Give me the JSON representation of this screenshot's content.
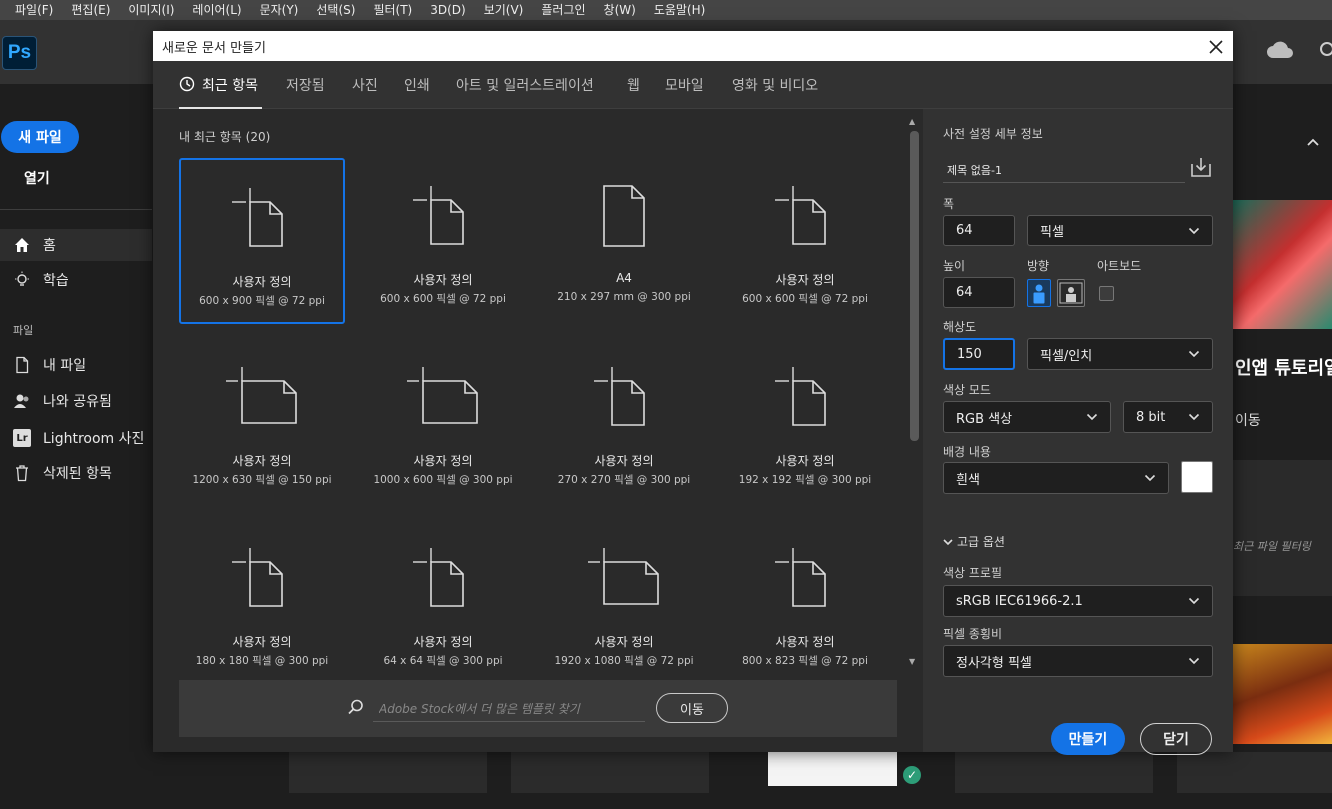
{
  "menubar": [
    "파일(F)",
    "편집(E)",
    "이미지(I)",
    "레이어(L)",
    "문자(Y)",
    "선택(S)",
    "필터(T)",
    "3D(D)",
    "보기(V)",
    "플러그인",
    "창(W)",
    "도움말(H)"
  ],
  "app": {
    "logo": "Ps"
  },
  "sidebar": {
    "new_file": "새 파일",
    "open": "열기",
    "items": [
      {
        "label": "홈",
        "icon": "home-icon"
      },
      {
        "label": "학습",
        "icon": "lightbulb-icon"
      }
    ],
    "section_label": "파일",
    "file_items": [
      {
        "label": "내 파일",
        "icon": "file-icon"
      },
      {
        "label": "나와 공유됨",
        "icon": "shared-icon"
      },
      {
        "label": "Lightroom 사진",
        "icon": "lightroom-icon",
        "badge": "Lr"
      },
      {
        "label": "삭제된 항목",
        "icon": "trash-icon"
      }
    ]
  },
  "background_panel": {
    "tutorial_title": "인앱 튜토리얼",
    "move": "이동",
    "filter_text": "최근 파일 필터링"
  },
  "dialog": {
    "title": "새로운 문서 만들기",
    "tabs": [
      "최근 항목",
      "저장됨",
      "사진",
      "인쇄",
      "아트 및 일러스트레이션",
      "웹",
      "모바일",
      "영화 및 비디오"
    ],
    "recent_label": "내 최근 항목",
    "recent_count": "(20)",
    "presets": [
      {
        "name": "사용자 정의",
        "desc": "600 x 900 픽셀 @ 72 ppi",
        "selected": true,
        "shape": "custom"
      },
      {
        "name": "사용자 정의",
        "desc": "600 x 600 픽셀 @ 72 ppi",
        "shape": "custom"
      },
      {
        "name": "A4",
        "desc": "210 x 297 mm @ 300 ppi",
        "shape": "doc"
      },
      {
        "name": "사용자 정의",
        "desc": "600 x 600 픽셀 @ 72 ppi",
        "shape": "custom"
      },
      {
        "name": "사용자 정의",
        "desc": "1200 x 630 픽셀 @ 150 ppi",
        "shape": "custom-wide"
      },
      {
        "name": "사용자 정의",
        "desc": "1000 x 600 픽셀 @ 300 ppi",
        "shape": "custom-wide"
      },
      {
        "name": "사용자 정의",
        "desc": "270 x 270 픽셀 @ 300 ppi",
        "shape": "custom"
      },
      {
        "name": "사용자 정의",
        "desc": "192 x 192 픽셀 @ 300 ppi",
        "shape": "custom"
      },
      {
        "name": "사용자 정의",
        "desc": "180 x 180 픽셀 @ 300 ppi",
        "shape": "custom"
      },
      {
        "name": "사용자 정의",
        "desc": "64 x 64 픽셀 @ 300 ppi",
        "shape": "custom"
      },
      {
        "name": "사용자 정의",
        "desc": "1920 x 1080 픽셀 @ 72 ppi",
        "shape": "custom-wide"
      },
      {
        "name": "사용자 정의",
        "desc": "800 x 823 픽셀 @ 72 ppi",
        "shape": "custom"
      }
    ],
    "stock_placeholder": "Adobe Stock에서 더 많은 템플릿 찾기",
    "stock_go": "이동",
    "settings": {
      "header": "사전 설정 세부 정보",
      "preset_name": "제목 없음-1",
      "width_label": "폭",
      "width_value": "64",
      "width_unit": "픽셀",
      "height_label": "높이",
      "height_value": "64",
      "orientation_label": "방향",
      "artboard_label": "아트보드",
      "resolution_label": "해상도",
      "resolution_value": "150",
      "resolution_unit": "픽셀/인치",
      "color_mode_label": "색상 모드",
      "color_mode": "RGB 색상",
      "bit_depth": "8 bit",
      "background_label": "배경 내용",
      "background_value": "흰색",
      "background_color": "#ffffff",
      "advanced_label": "고급 옵션",
      "color_profile_label": "색상 프로필",
      "color_profile": "sRGB IEC61966-2.1",
      "pixel_aspect_label": "픽셀 종횡비",
      "pixel_aspect": "정사각형 픽셀",
      "create_button": "만들기",
      "close_button": "닫기"
    }
  },
  "colors": {
    "accent": "#1473e6",
    "dialog_bg": "#2a2a2a",
    "panel_bg": "#323232"
  }
}
